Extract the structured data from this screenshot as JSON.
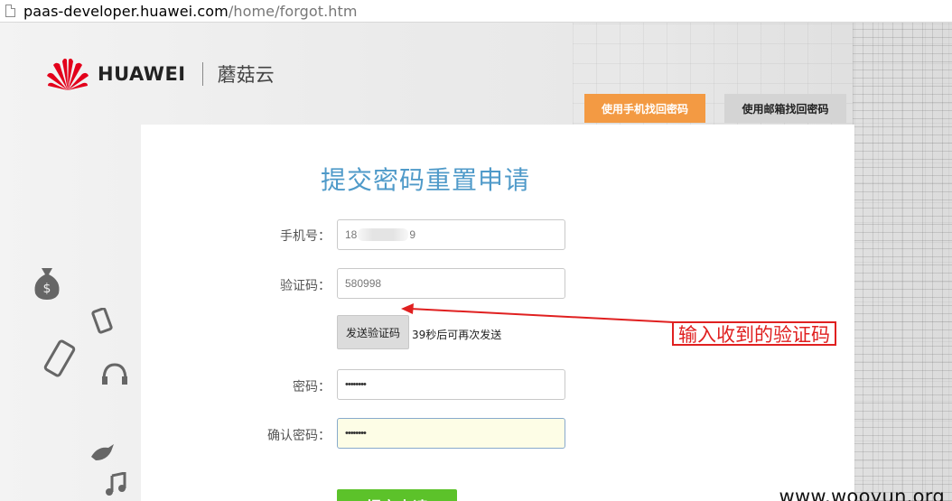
{
  "browser": {
    "url_host": "paas-developer.huawei.com",
    "url_path": "/home/forgot.htm"
  },
  "header": {
    "brand": "HUAWEI",
    "product": "蘑菇云"
  },
  "tabs": {
    "phone": "使用手机找回密码",
    "email": "使用邮箱找回密码"
  },
  "form": {
    "title": "提交密码重置申请",
    "phone_label": "手机号：",
    "phone_prefix": "18",
    "phone_suffix": "9",
    "code_label": "验证码：",
    "code_value": "580998",
    "send_button": "发送验证码",
    "countdown": "39秒后可再次发送",
    "password_label": "密码：",
    "password_value": "••••••••",
    "confirm_label": "确认密码：",
    "confirm_value": "••••••••",
    "submit": "提交申请"
  },
  "annotation": {
    "text": "输入收到的验证码"
  },
  "watermark": "www.wooyun.org",
  "colors": {
    "active_tab": "#f39a43",
    "submit": "#5cc22a",
    "title": "#4f9ac9",
    "annotation": "#e02020"
  }
}
